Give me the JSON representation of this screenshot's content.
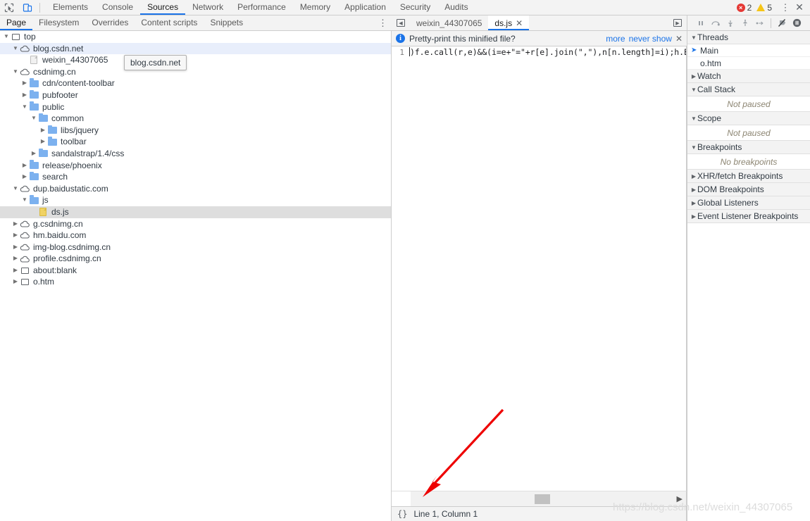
{
  "toolbar": {
    "icons": [
      {
        "name": "inspect-element-icon",
        "glyph": "inspect"
      },
      {
        "name": "device-toolbar-icon",
        "glyph": "device"
      }
    ],
    "panels": [
      {
        "label": "Elements",
        "active": false
      },
      {
        "label": "Console",
        "active": false
      },
      {
        "label": "Sources",
        "active": true
      },
      {
        "label": "Network",
        "active": false
      },
      {
        "label": "Performance",
        "active": false
      },
      {
        "label": "Memory",
        "active": false
      },
      {
        "label": "Application",
        "active": false
      },
      {
        "label": "Security",
        "active": false
      },
      {
        "label": "Audits",
        "active": false
      }
    ],
    "error_count": "2",
    "warning_count": "5",
    "kebab_label": "⋮",
    "close_label": "✕"
  },
  "navigator_tabs": [
    {
      "label": "Page",
      "active": true
    },
    {
      "label": "Filesystem",
      "active": false
    },
    {
      "label": "Overrides",
      "active": false
    },
    {
      "label": "Content scripts",
      "active": false
    },
    {
      "label": "Snippets",
      "active": false
    }
  ],
  "navigator_kebab": "⋮",
  "tree": [
    {
      "label": "top",
      "icon": "frame-icon",
      "indent": 0,
      "twisty": "open",
      "selected": "none"
    },
    {
      "label": "blog.csdn.net",
      "icon": "cloud-icon",
      "indent": 1,
      "twisty": "open",
      "selected": "blue"
    },
    {
      "label": "weixin_44307065",
      "icon": "document-icon",
      "indent": 2,
      "twisty": "none",
      "selected": "none"
    },
    {
      "label": "csdnimg.cn",
      "icon": "cloud-icon",
      "indent": 1,
      "twisty": "open",
      "selected": "none"
    },
    {
      "label": "cdn/content-toolbar",
      "icon": "folder-icon",
      "indent": 2,
      "twisty": "closed",
      "selected": "none"
    },
    {
      "label": "pubfooter",
      "icon": "folder-icon",
      "indent": 2,
      "twisty": "closed",
      "selected": "none"
    },
    {
      "label": "public",
      "icon": "folder-icon",
      "indent": 2,
      "twisty": "open",
      "selected": "none"
    },
    {
      "label": "common",
      "icon": "folder-icon",
      "indent": 3,
      "twisty": "open",
      "selected": "none"
    },
    {
      "label": "libs/jquery",
      "icon": "folder-icon",
      "indent": 4,
      "twisty": "closed",
      "selected": "none"
    },
    {
      "label": "toolbar",
      "icon": "folder-icon",
      "indent": 4,
      "twisty": "closed",
      "selected": "none"
    },
    {
      "label": "sandalstrap/1.4/css",
      "icon": "folder-icon",
      "indent": 3,
      "twisty": "closed",
      "selected": "none"
    },
    {
      "label": "release/phoenix",
      "icon": "folder-icon",
      "indent": 2,
      "twisty": "closed",
      "selected": "none"
    },
    {
      "label": "search",
      "icon": "folder-icon",
      "indent": 2,
      "twisty": "closed",
      "selected": "none"
    },
    {
      "label": "dup.baidustatic.com",
      "icon": "cloud-icon",
      "indent": 1,
      "twisty": "open",
      "selected": "none"
    },
    {
      "label": "js",
      "icon": "folder-icon",
      "indent": 2,
      "twisty": "open",
      "selected": "none"
    },
    {
      "label": "ds.js",
      "icon": "js-file-icon",
      "indent": 3,
      "twisty": "none",
      "selected": "grey"
    },
    {
      "label": "g.csdnimg.cn",
      "icon": "cloud-icon",
      "indent": 1,
      "twisty": "closed",
      "selected": "none"
    },
    {
      "label": "hm.baidu.com",
      "icon": "cloud-icon",
      "indent": 1,
      "twisty": "closed",
      "selected": "none"
    },
    {
      "label": "img-blog.csdnimg.cn",
      "icon": "cloud-icon",
      "indent": 1,
      "twisty": "closed",
      "selected": "none"
    },
    {
      "label": "profile.csdnimg.cn",
      "icon": "cloud-icon",
      "indent": 1,
      "twisty": "closed",
      "selected": "none"
    },
    {
      "label": "about:blank",
      "icon": "frame-icon",
      "indent": 1,
      "twisty": "closed",
      "selected": "none"
    },
    {
      "label": "o.htm",
      "icon": "frame-icon",
      "indent": 1,
      "twisty": "closed",
      "selected": "none"
    }
  ],
  "tooltip": {
    "text": "blog.csdn.net"
  },
  "editor": {
    "tabs": [
      {
        "label": "weixin_44307065",
        "active": false,
        "closable": false
      },
      {
        "label": "ds.js",
        "active": true,
        "closable": true
      }
    ],
    "tab_close_glyph": "✕",
    "nav_left_glyph": "◀",
    "nav_right_glyph": "▶",
    "infobar": {
      "message": "Pretty-print this minified file?",
      "link_more": "more",
      "link_never_show": "never show",
      "close_glyph": "✕",
      "icon_letter": "i",
      "accent_color": "#1a73e8"
    },
    "line_number": "1",
    "code": ")f.e.call(r,e)&&(i=e+\"=\"+r[e].join(\",\"),n[n.length]=i);h.Ei",
    "scrollbar": {
      "right_arrow_glyph": "▶"
    },
    "status": {
      "format_button": "{}",
      "position_text": "Line 1, Column 1"
    }
  },
  "debugger": {
    "controls": [
      {
        "name": "resume-script-execution-icon",
        "glyph": "pause"
      },
      {
        "name": "step-over-icon",
        "glyph": "step-over"
      },
      {
        "name": "step-into-icon",
        "glyph": "step-into"
      },
      {
        "name": "step-out-icon",
        "glyph": "step-out"
      },
      {
        "name": "step-icon",
        "glyph": "step"
      },
      {
        "name": "deactivate-breakpoints-icon",
        "glyph": "deactivate"
      },
      {
        "name": "pause-on-exceptions-icon",
        "glyph": "pause-exceptions"
      }
    ],
    "sections": [
      {
        "title": "Threads",
        "expanded": true,
        "name": "threads",
        "rows": [
          {
            "label": "Main",
            "marked": true
          },
          {
            "label": "o.htm",
            "marked": false
          }
        ],
        "empty": null
      },
      {
        "title": "Watch",
        "expanded": false,
        "name": "watch",
        "rows": [],
        "empty": null
      },
      {
        "title": "Call Stack",
        "expanded": true,
        "name": "call-stack",
        "rows": [],
        "empty": "Not paused"
      },
      {
        "title": "Scope",
        "expanded": true,
        "name": "scope",
        "rows": [],
        "empty": "Not paused"
      },
      {
        "title": "Breakpoints",
        "expanded": true,
        "name": "breakpoints",
        "rows": [],
        "empty": "No breakpoints"
      },
      {
        "title": "XHR/fetch Breakpoints",
        "expanded": false,
        "name": "xhr-fetch-breakpoints",
        "rows": [],
        "empty": null
      },
      {
        "title": "DOM Breakpoints",
        "expanded": false,
        "name": "dom-breakpoints",
        "rows": [],
        "empty": null
      },
      {
        "title": "Global Listeners",
        "expanded": false,
        "name": "global-listeners",
        "rows": [],
        "empty": null
      },
      {
        "title": "Event Listener Breakpoints",
        "expanded": false,
        "name": "event-listener-breakpoints",
        "rows": [],
        "empty": null
      }
    ]
  },
  "annotation": {
    "color": "#ee0000",
    "name": "red-arrow-annotation"
  },
  "watermark": {
    "text": "https://blog.csdn.net/weixin_44307065"
  }
}
